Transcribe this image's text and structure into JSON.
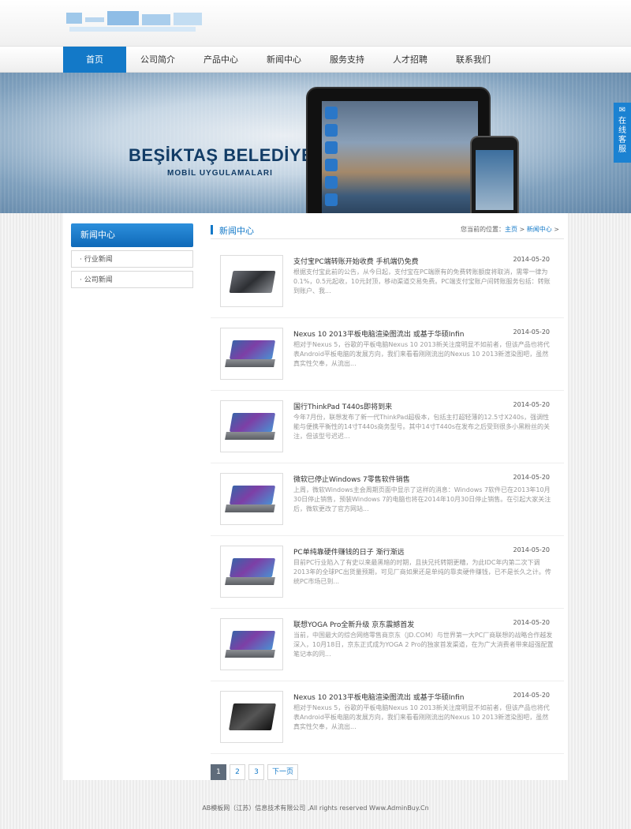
{
  "header": {
    "logo_alt": "logo"
  },
  "nav": {
    "items": [
      {
        "label": "首页",
        "active": true
      },
      {
        "label": "公司简介",
        "active": false
      },
      {
        "label": "产品中心",
        "active": false
      },
      {
        "label": "新闻中心",
        "active": false
      },
      {
        "label": "服务支持",
        "active": false
      },
      {
        "label": "人才招聘",
        "active": false
      },
      {
        "label": "联系我们",
        "active": false
      }
    ]
  },
  "banner": {
    "title": "BEŞİKTAŞ BELEDİYESİ",
    "subtitle": "MOBİL UYGULAMALARI"
  },
  "chat_tab": {
    "label": "在线客服"
  },
  "sidebar": {
    "title": "新闻中心",
    "items": [
      {
        "label": "· 行业新闻"
      },
      {
        "label": "· 公司新闻"
      }
    ]
  },
  "content": {
    "title": "新闻中心",
    "breadcrumb": {
      "prefix": "您当前的位置：",
      "home": "主页",
      "sep": " > ",
      "current": "新闻中心",
      "end": " >"
    },
    "news": [
      {
        "title": "支付宝PC端转账开始收费 手机端仍免费",
        "date": "2014-05-20",
        "desc": "根据支付宝此前的公告，从今日起，支付宝在PC端原有的免费转账额度将取消，需零一律为0.1%，0.5元起收，10元封顶，移动渠道交易免费。PC端支付宝账户间转账服务包括：转账到账户、我...",
        "thumb": "laptop-silver"
      },
      {
        "title": "Nexus 10 2013平板电脑渲染图流出 或基于华硕Infin",
        "date": "2014-05-20",
        "desc": "相对于Nexus 5，谷歌的平板电脑Nexus 10 2013新关注度明显不如前者，但该产品也将代表Android平板电脑的发展方向，我们来看看刚刚流出的Nexus 10 2013新渲染图吧，虽然真实性欠奉，从流出...",
        "thumb": "tablet-windows"
      },
      {
        "title": "国行ThinkPad T440s即将到来",
        "date": "2014-05-20",
        "desc": "今年7月份，联想发布了新一代ThinkPad超极本，包括主打超轻薄的12.5寸X240s，强调性能与便携平衡性的14寸T440s商务型号。其中14寸T440s在发布之后受到很多小黑粉丝的关注，但该型号迟迟...",
        "thumb": "laptop-windows"
      },
      {
        "title": "微软已停止Windows 7零售软件销售",
        "date": "2014-05-20",
        "desc": "上周，微软Windows主会周期页面中显示了这样的消息：Windows 7软件已在2013年10月30日停止销售，预装Windows 7的电脑也将在2014年10月30日停止销售。在引起大家关注后，微软更改了官方网站...",
        "thumb": "laptop-windows"
      },
      {
        "title": "PC单纯靠硬件赚钱的日子 渐行渐远",
        "date": "2014-05-20",
        "desc": "目前PC行业陷入了有史以来最黑暗的时期，且扶兄托转期更糟，为此IDC年内第二次下调2013年的全球PC出货量预期，可见厂商如果还是单纯的靠卖硬件赚钱，已不是长久之计。传统PC市场已到...",
        "thumb": "laptop-windows"
      },
      {
        "title": "联想YOGA Pro全新升级 京东震撼首发",
        "date": "2014-05-20",
        "desc": "当前，中国最大的综合网络零售商京东（JD.COM）与世界第一大PC厂商联想的战略合作越发深入，10月18日，京东正式成为YOGA 2 Pro的独家首发渠道，在为广大消费者带来超强配置笔记本的同...",
        "thumb": "laptop-windows"
      },
      {
        "title": "Nexus 10 2013平板电脑渲染图流出 或基于华硕Infin",
        "date": "2014-05-20",
        "desc": "相对于Nexus 5，谷歌的平板电脑Nexus 10 2013新关注度明显不如前者，但该产品也将代表Android平板电脑的发展方向，我们来看看刚刚流出的Nexus 10 2013新渲染图吧，虽然真实性欠奉，从流出...",
        "thumb": "tablet-black"
      }
    ]
  },
  "pager": {
    "pages": [
      "1",
      "2",
      "3"
    ],
    "current": "1",
    "next": "下一页"
  },
  "footer": {
    "text": "AB模板网（江苏）信息技术有限公司 ,All rights reserved Www.AdminBuy.Cn"
  },
  "colors": {
    "primary": "#1379c8",
    "date": "#555555",
    "desc": "#999999"
  }
}
